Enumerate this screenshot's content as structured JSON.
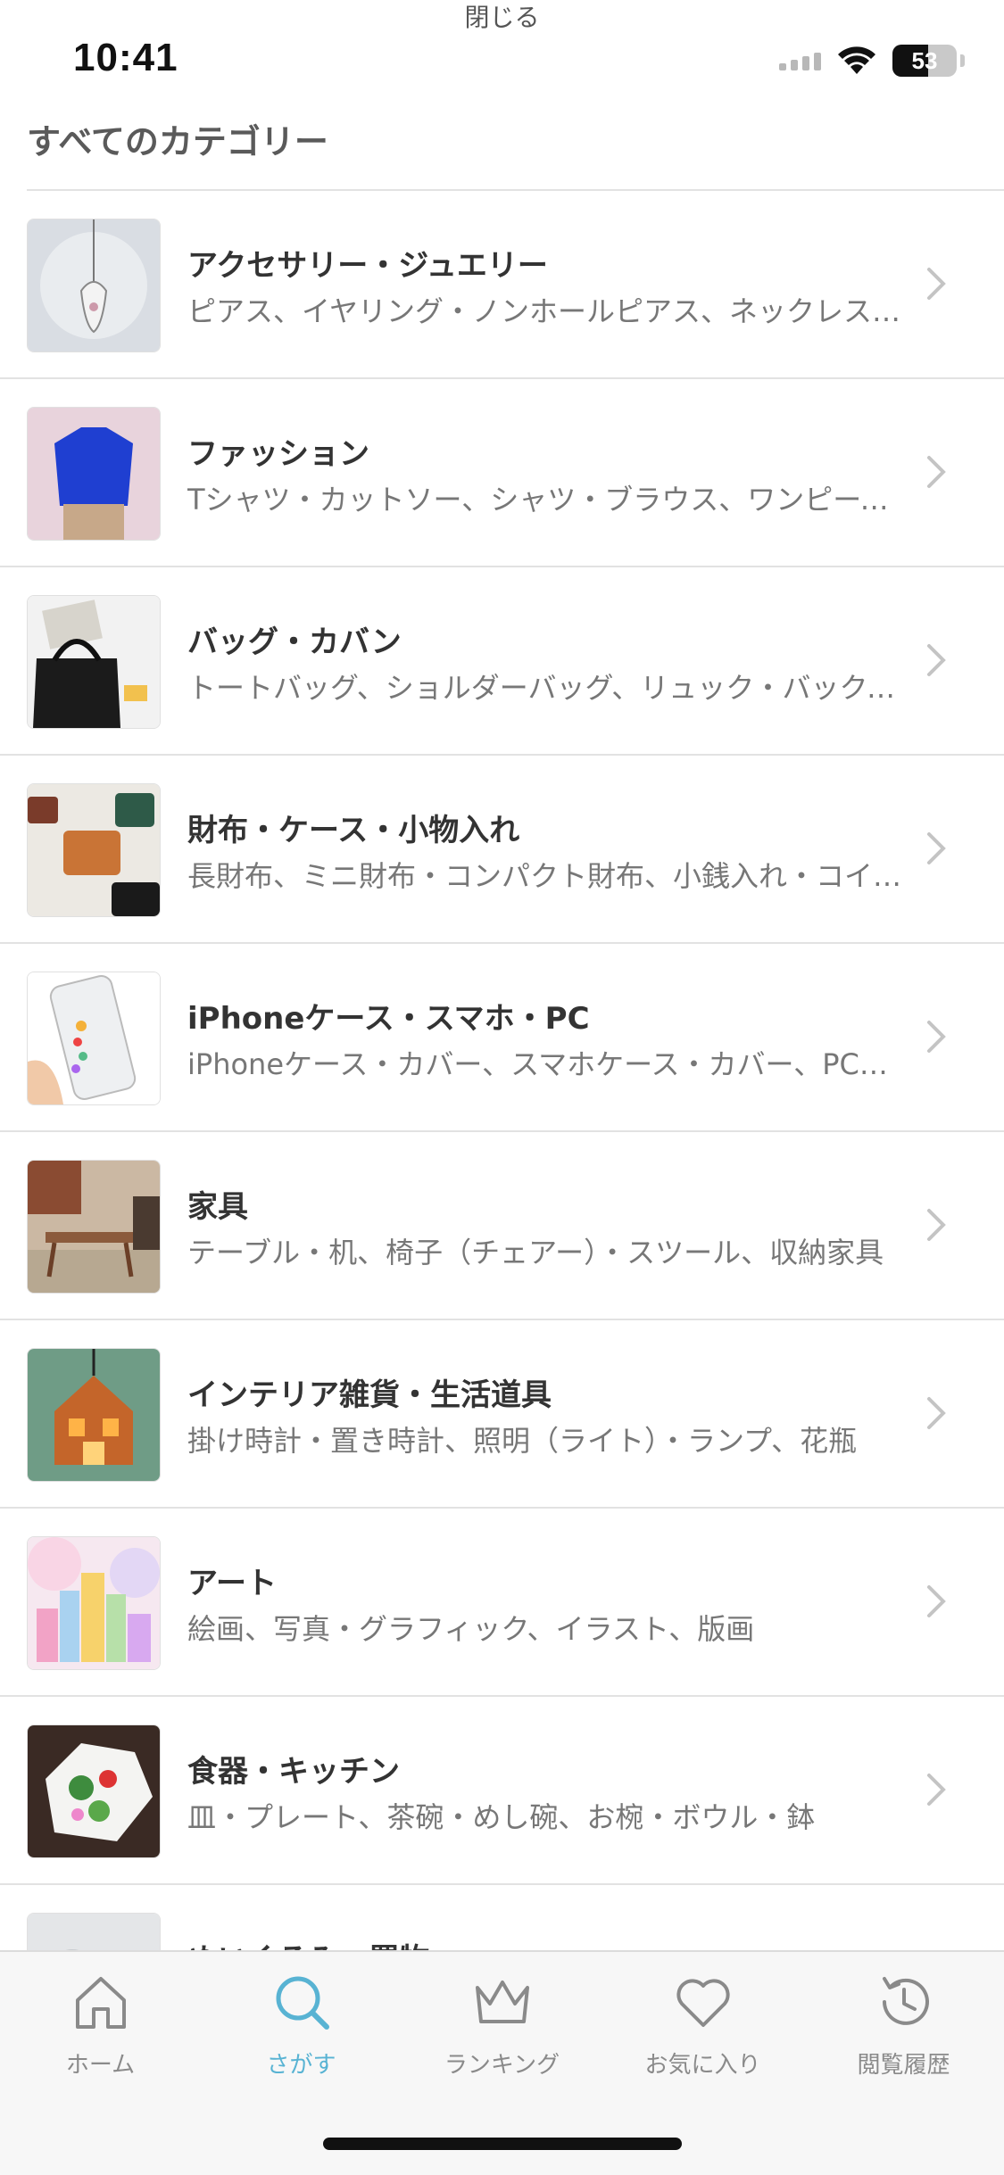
{
  "header": {
    "close_label": "閉じる",
    "time": "10:41",
    "battery_level": "53"
  },
  "section_title": "すべてのカテゴリー",
  "categories": [
    {
      "title": "アクセサリー・ジュエリー",
      "sub": "ピアス、イヤリング・ノンホールピアス、ネックレス・ペンダント"
    },
    {
      "title": "ファッション",
      "sub": "Tシャツ・カットソー、シャツ・ブラウス、ワンピース・チュニック"
    },
    {
      "title": "バッグ・カバン",
      "sub": "トートバッグ、ショルダーバッグ、リュック・バックパック"
    },
    {
      "title": "財布・ケース・小物入れ",
      "sub": "長財布、ミニ財布・コンパクト財布、小銭入れ・コインケース"
    },
    {
      "title": "iPhoneケース・スマホ・PC",
      "sub": "iPhoneケース・カバー、スマホケース・カバー、PCケース"
    },
    {
      "title": "家具",
      "sub": "テーブル・机、椅子（チェアー）・スツール、収納家具"
    },
    {
      "title": "インテリア雑貨・生活道具",
      "sub": "掛け時計・置き時計、照明（ライト）・ランプ、花瓶"
    },
    {
      "title": "アート",
      "sub": "絵画、写真・グラフィック、イラスト、版画"
    },
    {
      "title": "食器・キッチン",
      "sub": "皿・プレート、茶碗・めし碗、お椀・ボウル・鉢"
    },
    {
      "title": "ぬいぐるみ・置物",
      "sub": ""
    }
  ],
  "tabs": [
    {
      "label": "ホーム",
      "icon": "home-icon",
      "active": false
    },
    {
      "label": "さがす",
      "icon": "search-icon",
      "active": true
    },
    {
      "label": "ランキング",
      "icon": "crown-icon",
      "active": false
    },
    {
      "label": "お気に入り",
      "icon": "heart-icon",
      "active": false
    },
    {
      "label": "閲覧履歴",
      "icon": "history-icon",
      "active": false
    }
  ],
  "colors": {
    "accent": "#58b3d3",
    "inactive": "#8a8a8a"
  }
}
